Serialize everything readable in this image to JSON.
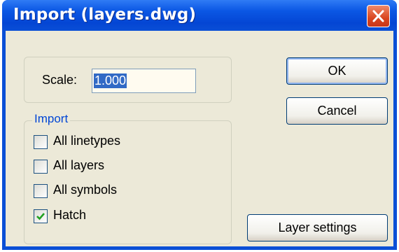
{
  "window": {
    "title": "Import (layers.dwg)"
  },
  "icons": {
    "close": "close-x-icon",
    "check": "checkmark-icon"
  },
  "scale": {
    "label": "Scale:",
    "value": "1.000"
  },
  "import_group": {
    "legend": "Import",
    "options": [
      {
        "label": "All linetypes",
        "checked": false
      },
      {
        "label": "All layers",
        "checked": false
      },
      {
        "label": "All symbols",
        "checked": false
      },
      {
        "label": "Hatch",
        "checked": true
      }
    ]
  },
  "buttons": {
    "ok": "OK",
    "cancel": "Cancel",
    "layer_settings": "Layer settings"
  },
  "colors": {
    "titlebar": "#0a4fd6",
    "client": "#ece9d8",
    "close": "#d9461f",
    "legend": "#0046d5",
    "selection": "#316ac5"
  }
}
